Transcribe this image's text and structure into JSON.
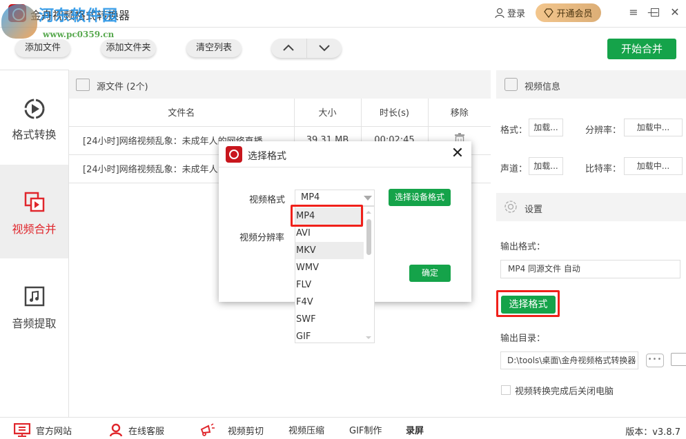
{
  "titlebar": {
    "app_title": "金舟视频格式转换器",
    "watermark_name": "河东软件园",
    "watermark_url": "www.pc0359.cn",
    "login_label": "登录",
    "vip_label": "开通会员"
  },
  "toolbar": {
    "add_file": "添加文件",
    "add_folder": "添加文件夹",
    "clear_list": "清空列表",
    "move_up": "︿",
    "move_down": "﹀",
    "start_merge": "开始合并"
  },
  "sidebar": {
    "items": [
      {
        "label": "格式转换",
        "icon": "play-circle-icon",
        "active": false
      },
      {
        "label": "视频合并",
        "icon": "video-merge-icon",
        "active": true
      },
      {
        "label": "音频提取",
        "icon": "music-note-icon",
        "active": false
      }
    ]
  },
  "filelist": {
    "header": "源文件 (2个)",
    "columns": [
      "文件名",
      "大小",
      "时长(s)",
      "移除"
    ],
    "rows": [
      {
        "name": "[24小时]网络视频乱象：未成年人的网络直播",
        "size": "39.31 MB",
        "duration": "00:02:45"
      },
      {
        "name": "[24小时]网络视频乱象：未成年人",
        "size": "",
        "duration": ""
      }
    ]
  },
  "video_info": {
    "title": "视频信息",
    "format_label": "格式：",
    "format_value": "加载...",
    "resolution_label": "分辨率：",
    "resolution_value": "加载中...",
    "channel_label": "声道：",
    "channel_value": "加载...",
    "bitrate_label": "比特率：",
    "bitrate_value": "加载中..."
  },
  "settings": {
    "title": "设置",
    "output_format_label": "输出格式：",
    "output_format_value": "MP4 同源文件 自动",
    "choose_format_button": "选择格式",
    "output_dir_label": "输出目录：",
    "output_dir_value": "D:\\tools\\桌面\\金舟视频格式转换器",
    "browse_button": "•••",
    "shutdown_checkbox_label": "视频转换完成后关闭电脑",
    "shutdown_checked": false
  },
  "bottombar": {
    "official_site": "官方网站",
    "online_service": "在线客服",
    "video_cut": "视频剪切",
    "video_compress": "视频压缩",
    "gif_make": "GIF制作",
    "screen_record": "录屏",
    "version": "版本：v3.8.7"
  },
  "modal": {
    "title": "选择格式",
    "video_format_label": "视频格式",
    "video_format_value": "MP4",
    "device_format_button": "选择设备格式",
    "resolution_label": "视频分辨率",
    "ok_button": "确定",
    "dropdown_options": [
      "MP4",
      "AVI",
      "MKV",
      "WMV",
      "FLV",
      "F4V",
      "SWF",
      "GIF"
    ],
    "highlighted_option": "MKV",
    "selected_option": "MP4"
  },
  "colors": {
    "accent_green": "#15a34a",
    "active_red": "#e0262c",
    "highlight_frame": "#f0201a"
  }
}
